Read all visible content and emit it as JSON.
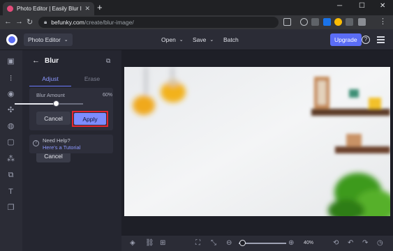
{
  "browser": {
    "tab_title": "Photo Editor | Easily Blur Images",
    "tab_close": "✕",
    "new_tab": "+",
    "url_host": "befunky.com",
    "url_path": "/create/blur-image/",
    "window_controls": [
      "─",
      "☐",
      "✕"
    ]
  },
  "header": {
    "photo_editor": "Photo Editor",
    "open": "Open",
    "save": "Save",
    "batch": "Batch",
    "upgrade": "Upgrade"
  },
  "panel": {
    "title": "Blur",
    "tabs": [
      "Adjust",
      "Erase"
    ],
    "blur_amount_label": "Blur Amount",
    "blur_amount_value": "60%",
    "blur_amount_fraction": 0.6,
    "cancel": "Cancel",
    "apply": "Apply",
    "help_title": "Need Help?",
    "help_link": "Here's a Tutorial"
  },
  "bottom": {
    "zoom": "40%",
    "zoom_fraction": 0.0
  },
  "colors": {
    "accent": "#5b6df5",
    "apply": "#7d8cff",
    "highlight": "#e4262f"
  },
  "icons": {
    "rail": [
      "edit-icon",
      "adjust-icon",
      "eye-icon",
      "effects-icon",
      "touch-up-icon",
      "frames-icon",
      "graphics-icon",
      "text-icon",
      "layers-icon"
    ]
  }
}
